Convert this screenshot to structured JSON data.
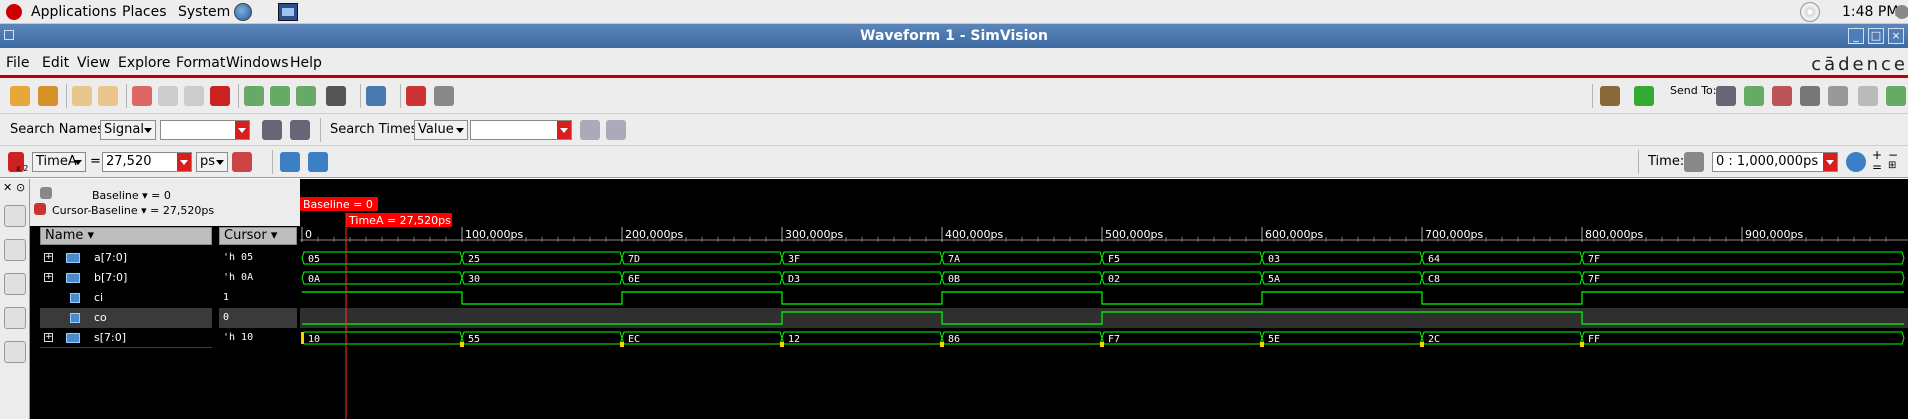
{
  "system_panel": {
    "menus": [
      "Applications",
      "Places",
      "System"
    ],
    "clock": "1:48 PM"
  },
  "window": {
    "title": "Waveform 1 - SimVision",
    "brand": "cādence"
  },
  "menubar": [
    "File",
    "Edit",
    "View",
    "Explore",
    "Format",
    "Windows",
    "Help"
  ],
  "toolbar1": {
    "send_to_label": "Send To:"
  },
  "search": {
    "names_label": "Search Names:",
    "names_mode": "Signal",
    "names_value": "",
    "times_label": "Search Times:",
    "times_mode": "Value",
    "times_value": ""
  },
  "cursor_bar": {
    "marker_sub": "x 2",
    "cursor_name": "TimeA",
    "equals": "=",
    "cursor_value": "27,520",
    "unit": "ps",
    "time_label": "Time:",
    "time_range": "0 : 1,000,000ps"
  },
  "baseline_info": {
    "baseline": "Baseline ▾ = 0",
    "cursor_baseline": "Cursor-Baseline ▾ = 27,520ps"
  },
  "columns": {
    "name": "Name ▾",
    "cursor": "Cursor ▾"
  },
  "signals": [
    {
      "name": "a[7:0]",
      "cursor": "'h 05",
      "bus": true,
      "expandable": true,
      "segments": [
        [
          "05",
          0
        ],
        [
          "25",
          100000
        ],
        [
          "7D",
          200000
        ],
        [
          "3F",
          300000
        ],
        [
          "7A",
          400000
        ],
        [
          "F5",
          500000
        ],
        [
          "03",
          600000
        ],
        [
          "64",
          700000
        ],
        [
          "7F",
          800000
        ]
      ]
    },
    {
      "name": "b[7:0]",
      "cursor": "'h 0A",
      "bus": true,
      "expandable": true,
      "segments": [
        [
          "0A",
          0
        ],
        [
          "30",
          100000
        ],
        [
          "6E",
          200000
        ],
        [
          "D3",
          300000
        ],
        [
          "0B",
          400000
        ],
        [
          "02",
          500000
        ],
        [
          "5A",
          600000
        ],
        [
          "C8",
          700000
        ],
        [
          "7F",
          800000
        ]
      ]
    },
    {
      "name": "ci",
      "cursor": "1",
      "bus": false,
      "expandable": false,
      "levels": [
        [
          1,
          0
        ],
        [
          0,
          100000
        ],
        [
          1,
          200000
        ],
        [
          0,
          300000
        ],
        [
          1,
          400000
        ],
        [
          0,
          500000
        ],
        [
          1,
          600000
        ],
        [
          0,
          700000
        ],
        [
          1,
          800000
        ]
      ]
    },
    {
      "name": "co",
      "cursor": "0",
      "bus": false,
      "expandable": false,
      "levels": [
        [
          0,
          0
        ],
        [
          1,
          300000
        ],
        [
          0,
          400000
        ],
        [
          1,
          500000
        ],
        [
          0,
          800000
        ]
      ]
    },
    {
      "name": "s[7:0]",
      "cursor": "'h 10",
      "bus": true,
      "expandable": true,
      "glitch_marks": true,
      "segments": [
        [
          "10",
          0
        ],
        [
          "55",
          100000
        ],
        [
          "EC",
          200000
        ],
        [
          "12",
          300000
        ],
        [
          "86",
          400000
        ],
        [
          "F7",
          500000
        ],
        [
          "5E",
          600000
        ],
        [
          "2C",
          700000
        ],
        [
          "FF",
          800000
        ]
      ]
    }
  ],
  "timeline": {
    "baseline_flag": "Baseline = 0",
    "cursor_flag": "TimeA = 27,520ps",
    "cursor_time": 27520,
    "ticks": [
      "0",
      "100,000ps",
      "200,000ps",
      "300,000ps",
      "400,000ps",
      "500,000ps",
      "600,000ps",
      "700,000ps",
      "800,000ps",
      "900,000ps"
    ],
    "range_end": 1000000
  },
  "colors": {
    "wave": "#00ff00",
    "cursor": "#ff3030",
    "flag_bg": "#ff0000",
    "background": "#000000"
  }
}
